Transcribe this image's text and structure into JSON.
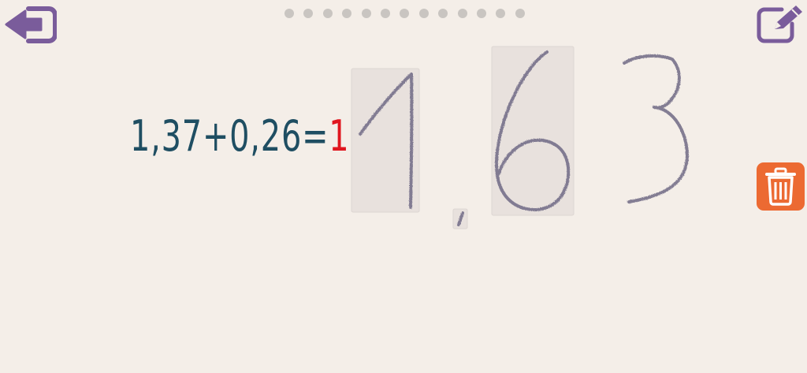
{
  "header": {
    "back_icon": "back-arrow-icon",
    "edit_icon": "pencil-edit-icon",
    "progress_total": 13,
    "progress_completed": 0
  },
  "equation": {
    "expression": "1,37+0,26=",
    "answer_typed": "1,6"
  },
  "handwriting": {
    "strokes_read_as": [
      "1",
      ",",
      "6",
      "3"
    ]
  },
  "trash": {
    "icon": "trash-icon"
  },
  "colors": {
    "background": "#f4eee8",
    "accent_purple": "#7a5c9b",
    "expression_teal": "#1f4e62",
    "answer_red": "#e0161f",
    "trash_orange": "#ec6a32",
    "ink": "#6f6a85",
    "box_fill": "#e8e1dd"
  }
}
